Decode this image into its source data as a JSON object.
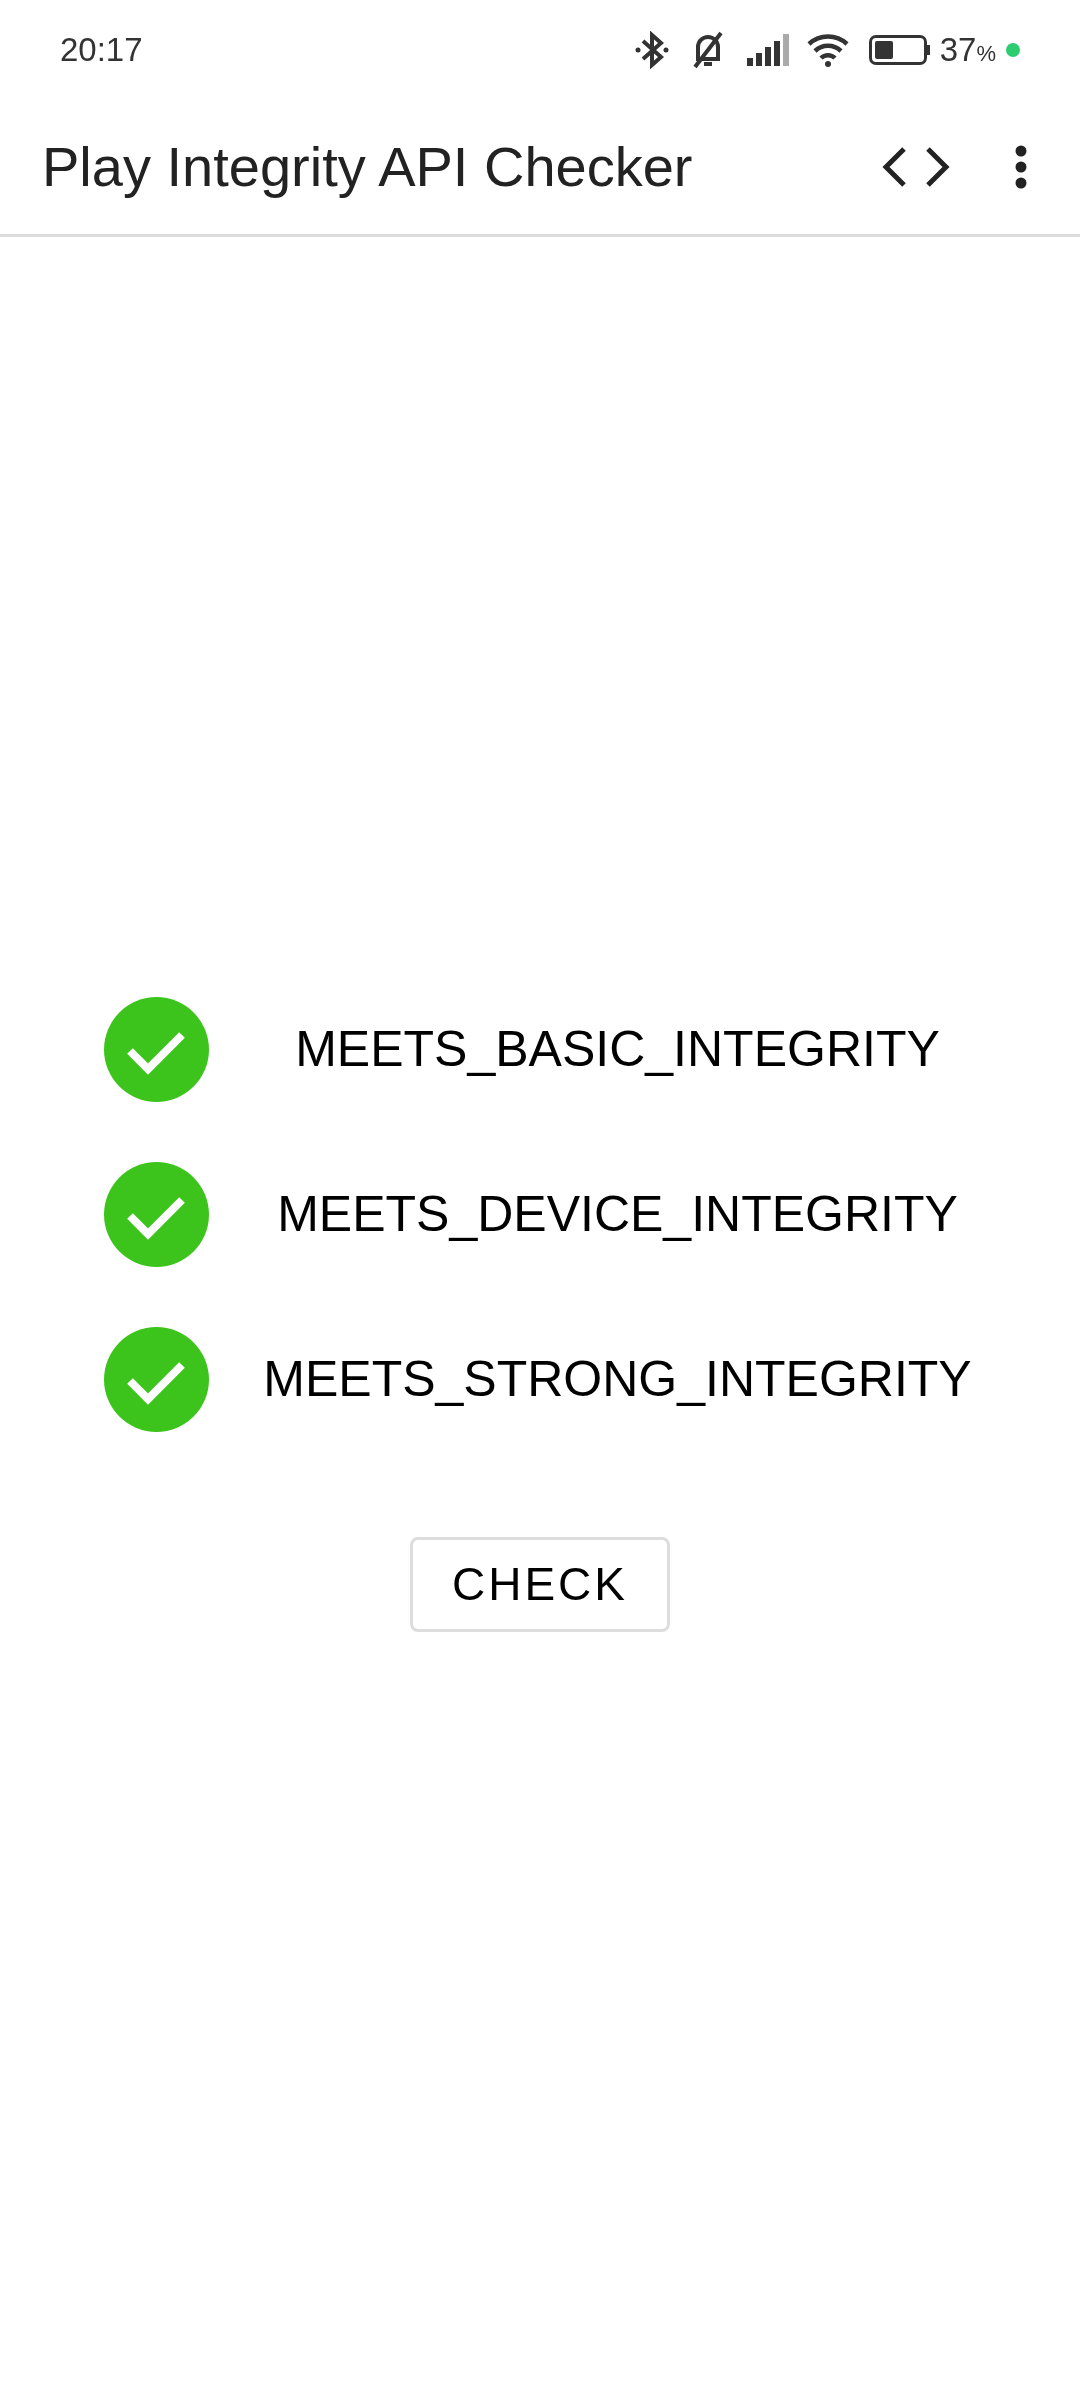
{
  "status_bar": {
    "time": "20:17",
    "battery_text": "37",
    "battery_unit": "%"
  },
  "app_bar": {
    "title": "Play Integrity API Checker"
  },
  "checks": [
    {
      "label": "MEETS_BASIC_INTEGRITY",
      "passed": true
    },
    {
      "label": "MEETS_DEVICE_INTEGRITY",
      "passed": true
    },
    {
      "label": "MEETS_STRONG_INTEGRITY",
      "passed": true
    }
  ],
  "button": {
    "label": "CHECK"
  }
}
